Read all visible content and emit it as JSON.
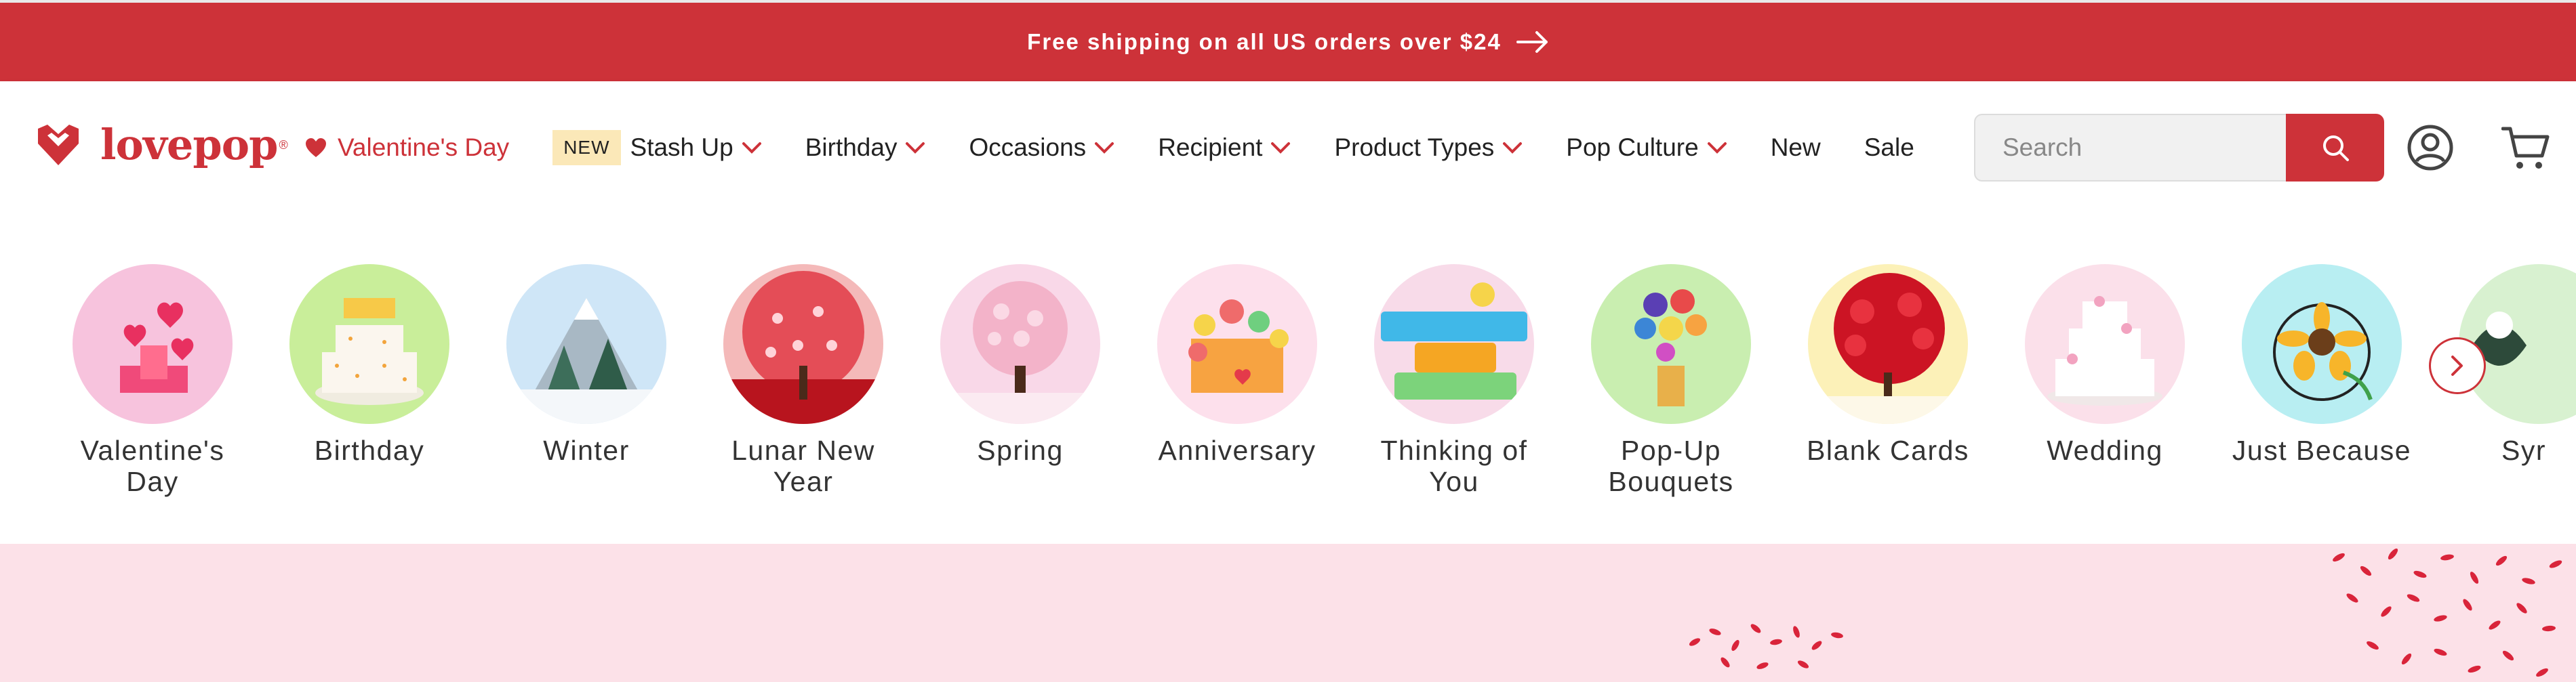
{
  "announcement": {
    "text": "Free shipping on all US orders over $24",
    "icon": "arrow-right-icon"
  },
  "brand": {
    "name": "lovepop",
    "mark": "®",
    "accent": "#cd3239"
  },
  "nav": {
    "valentines": "Valentine's Day",
    "new_badge": "NEW",
    "items": [
      {
        "label": "Stash Up",
        "dropdown": true
      },
      {
        "label": "Birthday",
        "dropdown": true
      },
      {
        "label": "Occasions",
        "dropdown": true
      },
      {
        "label": "Recipient",
        "dropdown": true
      },
      {
        "label": "Product Types",
        "dropdown": true
      },
      {
        "label": "Pop Culture",
        "dropdown": true
      },
      {
        "label": "New",
        "dropdown": false
      },
      {
        "label": "Sale",
        "dropdown": false
      }
    ]
  },
  "search": {
    "placeholder": "Search",
    "icon": "search-icon"
  },
  "header_icons": [
    "account-icon",
    "cart-icon"
  ],
  "categories": [
    {
      "label": "Valentine's Day",
      "bg": "#f7c3dd"
    },
    {
      "label": "Birthday",
      "bg": "#c9ee9a"
    },
    {
      "label": "Winter",
      "bg": "#cfe6f7"
    },
    {
      "label": "Lunar New Year",
      "bg": "#f4b9b9"
    },
    {
      "label": "Spring",
      "bg": "#f9d8e8"
    },
    {
      "label": "Anniversary",
      "bg": "#fde0ec"
    },
    {
      "label": "Thinking of You",
      "bg": "#f8dbe9"
    },
    {
      "label": "Pop-Up Bouquets",
      "bg": "#c9eeb0"
    },
    {
      "label": "Blank Cards",
      "bg": "#fcf1b8"
    },
    {
      "label": "Wedding",
      "bg": "#fbe0ea"
    },
    {
      "label": "Just Because",
      "bg": "#b8eef2"
    },
    {
      "label": "Syr",
      "bg": "#d8f1d0"
    }
  ]
}
